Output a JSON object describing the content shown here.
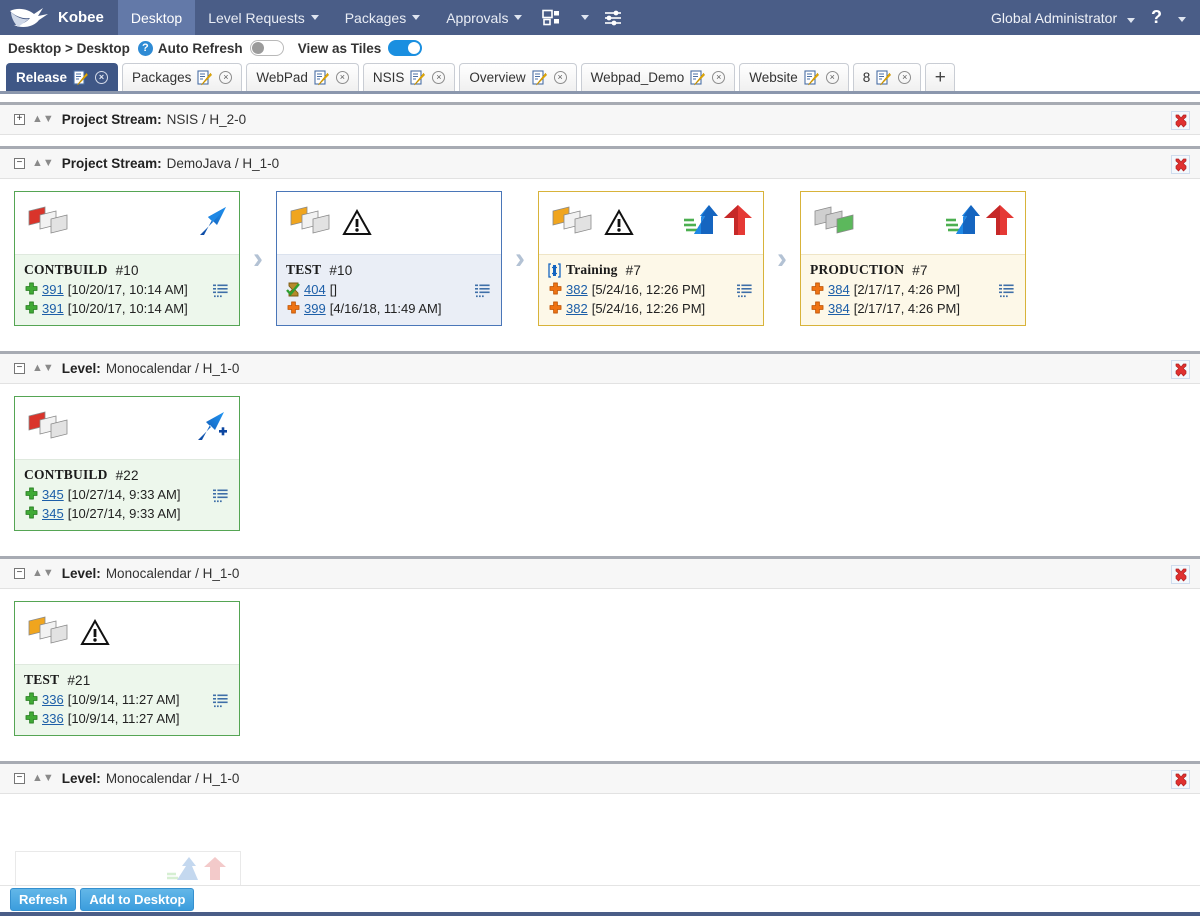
{
  "topnav": {
    "brand": "Kobee",
    "logo_icon": "hummingbird-logo-icon",
    "items": [
      {
        "label": "Desktop",
        "active": true,
        "caret": false
      },
      {
        "label": "Level Requests",
        "active": false,
        "caret": true
      },
      {
        "label": "Packages",
        "active": false,
        "caret": true
      },
      {
        "label": "Approvals",
        "active": false,
        "caret": true
      }
    ],
    "sitemap_icon": "sitemap-icon",
    "sitemap_caret": "chevron-down-icon",
    "sliders_icon": "sliders-icon",
    "user": "Global Administrator",
    "help": "?",
    "help_caret": "chevron-down-icon"
  },
  "breadcrumb": {
    "path": "Desktop > Desktop",
    "help_icon_label": "?",
    "auto_refresh_label": "Auto Refresh",
    "auto_refresh_on": false,
    "view_as_tiles_label": "View as Tiles",
    "view_as_tiles_on": true
  },
  "tabs": {
    "items": [
      {
        "label": "Release",
        "active": true
      },
      {
        "label": "Packages",
        "active": false
      },
      {
        "label": "WebPad",
        "active": false
      },
      {
        "label": "NSIS",
        "active": false
      },
      {
        "label": "Overview",
        "active": false
      },
      {
        "label": "Webpad_Demo",
        "active": false
      },
      {
        "label": "Website",
        "active": false
      },
      {
        "label": "8",
        "active": false
      }
    ],
    "add_label": "+",
    "close_glyph": "×",
    "edit_icon": "note-edit-icon"
  },
  "panels": [
    {
      "expander": "+",
      "collapsed": true,
      "title_label": "Project Stream:",
      "title_value": "NSIS / H_2-0",
      "delete_icon": "delete-x-icon",
      "tiles": []
    },
    {
      "expander": "−",
      "collapsed": false,
      "title_label": "Project Stream:",
      "title_value": "DemoJava / H_1-0",
      "delete_icon": "delete-x-icon",
      "tiles": [
        {
          "name": "CONTBUILD",
          "number": "#10",
          "border": "green",
          "stack_icon": "stack-red-icon",
          "warning": false,
          "prefix_icon": null,
          "right_icons": [
            "blue-arrow-up-icon"
          ],
          "rows": [
            {
              "icon": "plus-green-icon",
              "link": "391",
              "meta": "[10/20/17, 10:14 AM]",
              "list_icon": "list-icon"
            },
            {
              "icon": "plus-green-icon",
              "link": "391",
              "meta": "[10/20/17, 10:14 AM]",
              "list_icon": null
            }
          ]
        },
        {
          "name": "TEST",
          "number": "#10",
          "border": "blue",
          "stack_icon": "stack-orange-icon",
          "warning": true,
          "prefix_icon": null,
          "right_icons": [],
          "rows": [
            {
              "icon": "hourglass-green-icon",
              "link": "404",
              "meta": "[]",
              "list_icon": "list-icon"
            },
            {
              "icon": "plus-orange-icon",
              "link": "399",
              "meta": "[4/16/18, 11:49 AM]",
              "list_icon": null
            }
          ]
        },
        {
          "name": "Training",
          "number": "#7",
          "border": "gold",
          "stack_icon": "stack-orange-icon",
          "warning": true,
          "prefix_icon": "resource-blue-icon",
          "right_icons": [
            "green-blue-arrow-up-icon",
            "red-arrow-up-icon"
          ],
          "rows": [
            {
              "icon": "plus-orange-icon",
              "link": "382",
              "meta": "[5/24/16, 12:26 PM]",
              "list_icon": "list-icon"
            },
            {
              "icon": "plus-orange-icon",
              "link": "382",
              "meta": "[5/24/16, 12:26 PM]",
              "list_icon": null
            }
          ]
        },
        {
          "name": "PRODUCTION",
          "number": "#7",
          "border": "gold",
          "stack_icon": "stack-green-icon",
          "warning": false,
          "prefix_icon": null,
          "right_icons": [
            "green-blue-arrow-up-icon",
            "red-arrow-up-icon"
          ],
          "rows": [
            {
              "icon": "plus-orange-icon",
              "link": "384",
              "meta": "[2/17/17, 4:26 PM]",
              "list_icon": "list-icon"
            },
            {
              "icon": "plus-orange-icon",
              "link": "384",
              "meta": "[2/17/17, 4:26 PM]",
              "list_icon": null
            }
          ]
        }
      ]
    },
    {
      "expander": "−",
      "collapsed": false,
      "title_label": "Level:",
      "title_value": "Monocalendar / H_1-0",
      "delete_icon": "delete-x-icon",
      "tiles": [
        {
          "name": "CONTBUILD",
          "number": "#22",
          "border": "green",
          "stack_icon": "stack-red-icon",
          "warning": false,
          "prefix_icon": null,
          "right_icons": [
            "blue-arrow-up-plus-icon"
          ],
          "rows": [
            {
              "icon": "plus-green-icon",
              "link": "345",
              "meta": "[10/27/14, 9:33 AM]",
              "list_icon": "list-icon"
            },
            {
              "icon": "plus-green-icon",
              "link": "345",
              "meta": "[10/27/14, 9:33 AM]",
              "list_icon": null
            }
          ]
        }
      ]
    },
    {
      "expander": "−",
      "collapsed": false,
      "title_label": "Level:",
      "title_value": "Monocalendar / H_1-0",
      "delete_icon": "delete-x-icon",
      "tiles": [
        {
          "name": "TEST",
          "number": "#21",
          "border": "green",
          "stack_icon": "stack-orange-icon",
          "warning": true,
          "prefix_icon": null,
          "right_icons": [],
          "rows": [
            {
              "icon": "plus-green-icon",
              "link": "336",
              "meta": "[10/9/14, 11:27 AM]",
              "list_icon": "list-icon"
            },
            {
              "icon": "plus-green-icon",
              "link": "336",
              "meta": "[10/9/14, 11:27 AM]",
              "list_icon": null
            }
          ]
        }
      ]
    },
    {
      "expander": "−",
      "collapsed": false,
      "title_label": "Level:",
      "title_value": "Monocalendar / H_1-0",
      "delete_icon": "delete-x-icon",
      "tiles": []
    }
  ],
  "bottombar": {
    "refresh_label": "Refresh",
    "add_to_desktop_label": "Add to Desktop"
  }
}
